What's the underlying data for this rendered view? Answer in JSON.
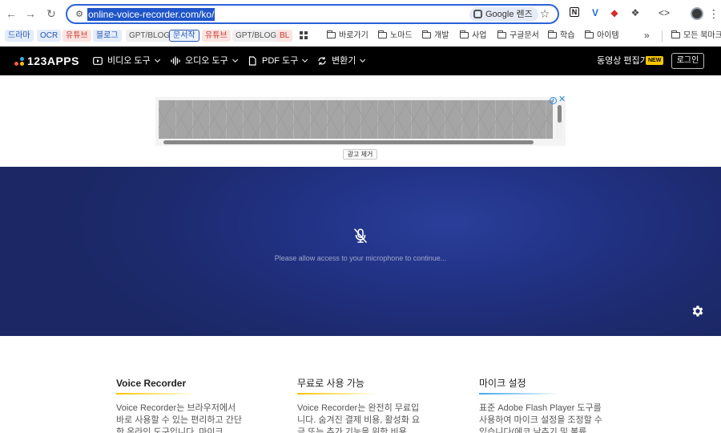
{
  "browser": {
    "url": "online-voice-recorder.com/ko/",
    "lens_label": "Google 렌즈",
    "bookmarks": [
      {
        "label": "드라마",
        "style": "blue"
      },
      {
        "label": "OCR",
        "style": "blue"
      },
      {
        "label": "유튜브",
        "style": "red"
      },
      {
        "label": "블로그",
        "style": "blue"
      },
      {
        "label": "GPT/BLOG",
        "style": "gray"
      },
      {
        "label": "문서작",
        "style": "outline"
      },
      {
        "label": "유튜브",
        "style": "red"
      },
      {
        "label": "GPT/BLOG",
        "style": "gray"
      },
      {
        "label": "BL",
        "style": "red"
      }
    ],
    "folders": [
      "바로가기",
      "노마드",
      "개발",
      "사업",
      "구글문서",
      "학습",
      "아이템"
    ],
    "all_bookmarks_label": "모든 북마크",
    "more_label": "»"
  },
  "site": {
    "logo_text": "123APPS",
    "menu": [
      {
        "label": "비디오 도구",
        "icon": "play-icon"
      },
      {
        "label": "오디오 도구",
        "icon": "waveform-icon"
      },
      {
        "label": "PDF 도구",
        "icon": "document-icon"
      },
      {
        "label": "변환기",
        "icon": "convert-icon"
      }
    ],
    "editor_label": "동영상 편집기",
    "new_badge": "NEW",
    "login_label": "로그인"
  },
  "ad": {
    "remove_label": "광고 제거"
  },
  "recorder": {
    "permission_text": "Please allow access to your microphone to continue...",
    "colors": {
      "background": "#1f2d75",
      "accent": "#2a3f9a"
    }
  },
  "features": [
    {
      "title": "Voice Recorder",
      "text": "Voice Recorder는 브라우저에서 바로 사용할 수 있는 편리하고 간단한 온라인 도구입니다. 마이크",
      "accent": "#f5c400"
    },
    {
      "title": "무료로 사용 가능",
      "text": "Voice Recorder는 완전히 무료입니다. 숨겨진 결제 비용, 활성화 요금 또는 추가 기능을 위한 비용",
      "accent": "#f5c400"
    },
    {
      "title": "마이크 설정",
      "text": "표준 Adobe Flash Player 도구를 사용하여 마이크 설정을 조정할 수 있습니다(에코 낮추기 및 볼륨",
      "accent": "#3fa7e8"
    }
  ]
}
